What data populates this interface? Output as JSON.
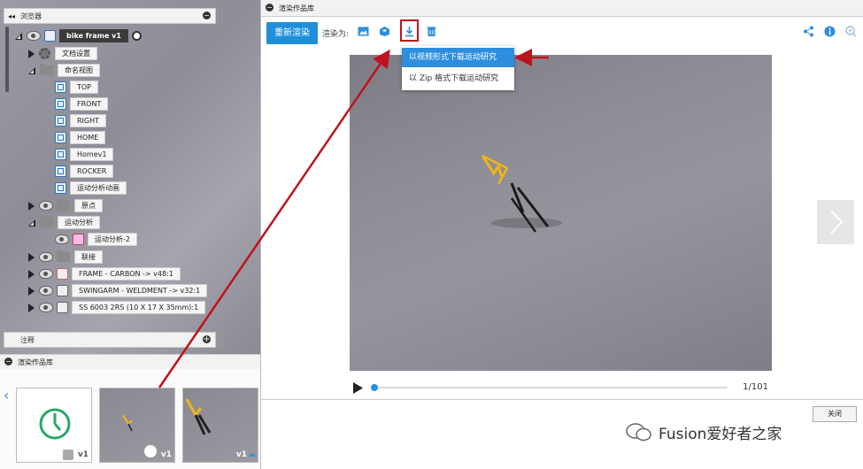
{
  "browser": {
    "title": "浏览器",
    "root": "bike frame v1",
    "items": [
      {
        "label": "文档设置"
      },
      {
        "label": "命名视图"
      },
      {
        "label": "TOP"
      },
      {
        "label": "FRONT"
      },
      {
        "label": "RIGHT"
      },
      {
        "label": "HOME"
      },
      {
        "label": "Homev1"
      },
      {
        "label": "ROCKER"
      },
      {
        "label": "运动分析动画"
      },
      {
        "label": "原点"
      },
      {
        "label": "运动分析"
      },
      {
        "label": "运动分析-2"
      },
      {
        "label": "联接"
      },
      {
        "label": "FRAME - CARBON -> v48:1"
      },
      {
        "label": "SWINGARM - WELDMENT -> v32:1"
      },
      {
        "label": "SS 6003 2RS (10 X 17 X 35mm):1"
      }
    ]
  },
  "notes": {
    "title": "注释"
  },
  "gallery_strip": {
    "title": "渲染作品库",
    "thumbs": [
      {
        "version": "v1"
      },
      {
        "version": "v1"
      },
      {
        "version": "v1"
      }
    ]
  },
  "dialog": {
    "title": "渲染作品库",
    "rerender_label": "重新渲染",
    "render_as_label": "渲染为:",
    "dropdown": [
      "以视频形式下载运动研究",
      "以 Zip 格式下载运动研究"
    ],
    "frame_counter": "1/101",
    "progress": 0.0,
    "close_label": "关闭"
  },
  "watermark": {
    "text": "Fusion爱好者之家"
  },
  "colors": {
    "accent": "#1f8fd9",
    "highlight": "#2d8ee0",
    "annotation": "#c0121d"
  },
  "icons": [
    "back-icon",
    "minus-icon",
    "eye-icon",
    "gear-icon",
    "folder-icon",
    "view-icon",
    "image-icon",
    "render-icon",
    "download-icon",
    "trash-icon",
    "share-icon",
    "info-icon",
    "zoom-icon",
    "play-icon",
    "chevron-right-icon",
    "chevron-left-icon",
    "timer-icon"
  ]
}
